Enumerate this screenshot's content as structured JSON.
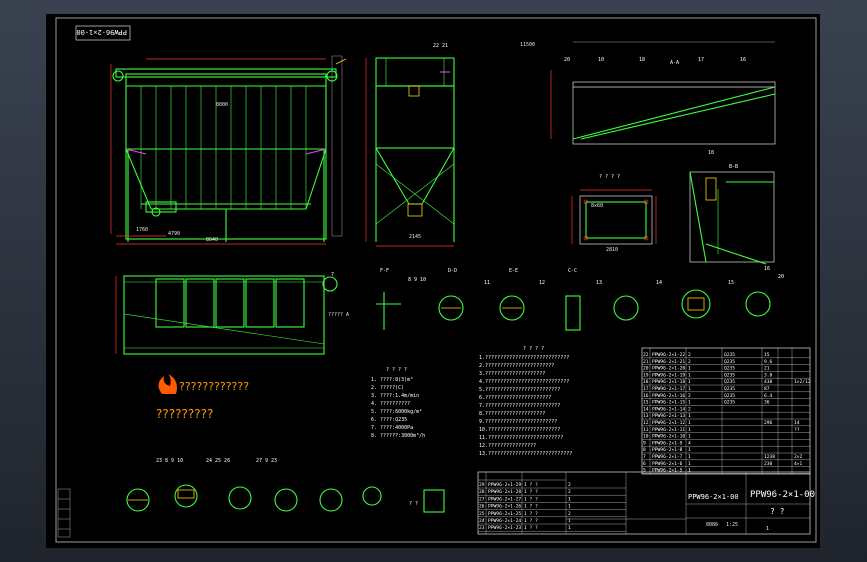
{
  "drawing": {
    "title_stamp": "PPW96-2×1-00",
    "title_block_code": "PPW96-2×1-00",
    "title_block_name": "? ?",
    "logo_line": "????????????",
    "logo_line2": "?????????",
    "tech_req_heading": "? ? ? ?",
    "notes_heading": "? ? ? ?",
    "section_labels": [
      "F-F",
      "D-D",
      "E-E",
      "A-A",
      "B-B",
      "C-C"
    ],
    "title_block_rows": [
      {
        "no": "29",
        "code": "PPW96-2×1-29",
        "name": "1  ? ?",
        "qty": "2"
      },
      {
        "no": "28",
        "code": "PPW96-2×1-28",
        "name": "1  ? ?",
        "qty": "2"
      },
      {
        "no": "27",
        "code": "PPW96-2×1-27",
        "name": "1  ? ?",
        "qty": "1"
      },
      {
        "no": "26",
        "code": "PPW96-2×1-26",
        "name": "1  ? ?",
        "qty": "1"
      },
      {
        "no": "25",
        "code": "PPW96-2×1-25",
        "name": "1  ? ?",
        "qty": "2"
      },
      {
        "no": "24",
        "code": "PPW96-2×1-24",
        "name": "1  ? ?",
        "qty": "1"
      },
      {
        "no": "23",
        "code": "PPW96-2×1-23",
        "name": "1  ? ?",
        "qty": "1"
      }
    ],
    "parts_list": [
      {
        "no": "22",
        "code": "PPW96-2×1-22",
        "qty": "2",
        "mat": "Q235",
        "w": "15",
        "note": ""
      },
      {
        "no": "21",
        "code": "PPW96-2×1-21",
        "qty": "2",
        "mat": "Q235",
        "w": "9.6",
        "note": ""
      },
      {
        "no": "20",
        "code": "PPW96-2×1-20",
        "qty": "1",
        "mat": "Q235",
        "w": "21",
        "note": ""
      },
      {
        "no": "19",
        "code": "PPW96-2×1-19",
        "qty": "1",
        "mat": "Q235",
        "w": "3.8",
        "note": ""
      },
      {
        "no": "18",
        "code": "PPW96-2×1-18",
        "qty": "1",
        "mat": "Q235",
        "w": "438",
        "note": "1×2/12"
      },
      {
        "no": "17",
        "code": "PPW96-2×1-17",
        "qty": "1",
        "mat": "Q235",
        "w": "87",
        "note": ""
      },
      {
        "no": "16",
        "code": "PPW96-2×1-16",
        "qty": "2",
        "mat": "Q235",
        "w": "6.4",
        "note": ""
      },
      {
        "no": "15",
        "code": "PPW96-2×1-15",
        "qty": "1",
        "mat": "Q235",
        "w": "36",
        "note": ""
      },
      {
        "no": "14",
        "code": "PPW96-2×1-14",
        "qty": "2",
        "mat": "",
        "w": "",
        "note": ""
      },
      {
        "no": "13",
        "code": "PPW96-2×1-13",
        "qty": "1",
        "mat": "",
        "w": "",
        "note": ""
      },
      {
        "no": "12",
        "code": "PPW96-2×1-12",
        "qty": "1",
        "mat": "",
        "w": "296",
        "note": "14"
      },
      {
        "no": "11",
        "code": "PPW96-2×1-11",
        "qty": "1",
        "mat": "",
        "w": "",
        "note": "??"
      },
      {
        "no": "10",
        "code": "PPW96-2×1-10",
        "qty": "1",
        "mat": "",
        "w": "",
        "note": ""
      },
      {
        "no": "9",
        "code": "PPW96-2×1-9",
        "qty": "4",
        "mat": "",
        "w": "",
        "note": ""
      },
      {
        "no": "8",
        "code": "PPW96-2×1-8",
        "qty": "1",
        "mat": "",
        "w": "",
        "note": ""
      },
      {
        "no": "7",
        "code": "PPW96-2×1-7",
        "qty": "1",
        "mat": "",
        "w": "1238",
        "note": "2×2"
      },
      {
        "no": "6",
        "code": "PPW96-2×1-6",
        "qty": "1",
        "mat": "",
        "w": "230",
        "note": "4×1"
      },
      {
        "no": "5",
        "code": "PPW96-2×1-5",
        "qty": "1",
        "mat": "",
        "w": "",
        "note": ""
      }
    ],
    "scale": "1:25",
    "sheet": "1",
    "weight": "8086"
  }
}
